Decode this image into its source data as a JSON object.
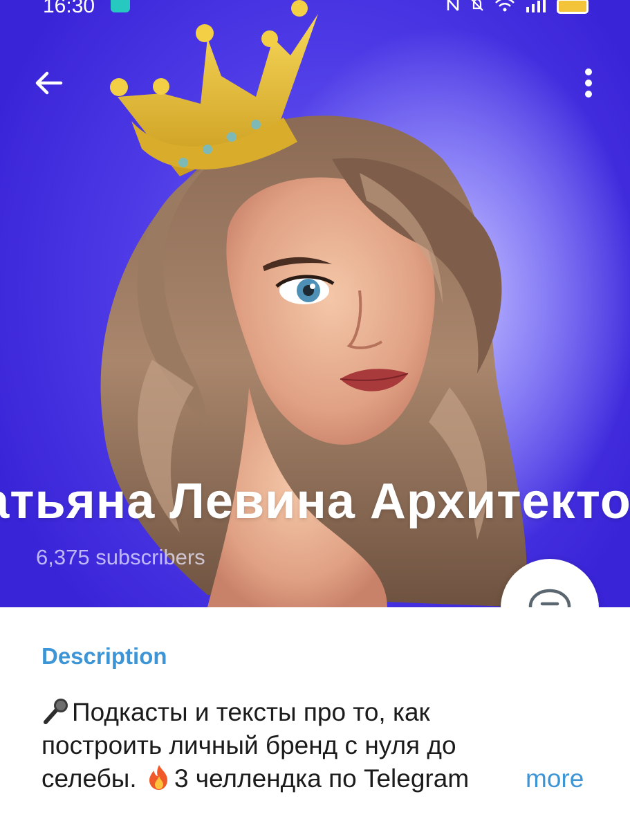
{
  "status_bar": {
    "time": "16:30",
    "icons": [
      "nfc-icon",
      "mute-icon",
      "wifi-icon",
      "signal-icon",
      "battery-icon"
    ]
  },
  "header": {
    "back_icon": "arrow-left-icon",
    "menu_icon": "more-vertical-icon",
    "title": "Татьяна Левина   Архитектор",
    "title_visible": "льяна Левина   Архите",
    "subscribers": "6,375 subscribers",
    "avatar": "illustrated-woman-with-crown",
    "banner_color": "#4e3be6"
  },
  "discuss_button": {
    "icon": "chat-bubble-icon"
  },
  "description": {
    "heading": "Description",
    "line1_text": "Подкасты и тексты про то, как",
    "line1_emoji": "microphone-icon",
    "line2_text": "построить личный бренд с нуля до",
    "line3_text_a": "селебы. ",
    "line3_emoji": "fire-icon",
    "line3_text_b": "3 челлендка по Telegram",
    "more_label": "more",
    "accent_color": "#3d95d6"
  }
}
